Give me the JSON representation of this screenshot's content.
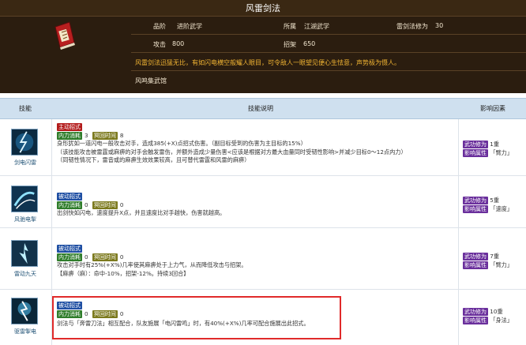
{
  "title": "风雷剑法",
  "header": {
    "grade_label": "品阶",
    "grade_value": "进阶武学",
    "faction_label": "所属",
    "faction_value": "江湖武学",
    "cultivation_label": "雷剑法修为",
    "cultivation_value": "30",
    "attack_label": "攻击",
    "attack_value": "800",
    "parry_label": "招架",
    "parry_value": "650",
    "description": "风雷剑法迅猛无比，有如闪电横空般耀人眼目，可令敌人一眼望见便心生怯意，声势极为慑人。",
    "source": "风鸣集武馆"
  },
  "columns": {
    "skill": "技能",
    "desc": "技能说明",
    "influence": "影响因素"
  },
  "rows": [
    {
      "name": "剑电闪雷",
      "type_tag": "主动招式",
      "neili_label": "内力消耗",
      "neili_value": "3",
      "cd_label": "冥回时间",
      "cd_value": "8",
      "lines": [
        "身形犹如一道闪电一般攻击对手，造成385(+X)点招式伤害。（副目标受到的伤害为主目标的15%）",
        "（该技能攻击被雷霆或麻痹的对手会触发雷伤，并额外造成少量伤害<应该是根据对方最大血量同时受韧性影响>并减少目标0～12点内力）",
        "（同韧性情况下，雷音或的麻痹生效效果较高，且可替代雷霆和风雷的麻痹）"
      ],
      "inf_tag1": "武功修为",
      "inf_val1": "1重",
      "inf_tag2": "影响属性",
      "inf_val2": "「臂力」"
    },
    {
      "name": "风驰电掣",
      "type_tag": "被动招式",
      "neili_label": "内力消耗",
      "neili_value": "0",
      "cd_label": "冥回时间",
      "cd_value": "0",
      "lines": [
        "出剑快如闪电，速度提升X点，并且速度比对手越快，伤害就越高。"
      ],
      "inf_tag1": "武功修为",
      "inf_val1": "5重",
      "inf_tag2": "影响属性",
      "inf_val2": "「速度」"
    },
    {
      "name": "雷动九天",
      "type_tag": "被动招式",
      "neili_label": "内力消耗",
      "neili_value": "0",
      "cd_label": "冥回时间",
      "cd_value": "0",
      "lines": [
        "攻击对手时有25%(+X%)几率使其麻痹处于上力气，从而降低攻击与招架。",
        "【麻痹（麻）：命中-10%，招架-12%。持续3回合】"
      ],
      "inf_tag1": "武功修为",
      "inf_val1": "7重",
      "inf_tag2": "影响属性",
      "inf_val2": "「臂力」"
    },
    {
      "name": "驱雷掣电",
      "type_tag": "被动招式",
      "neili_label": "内力消耗",
      "neili_value": "0",
      "cd_label": "冥回时间",
      "cd_value": "0",
      "lines": [
        "剑法与「奔雷刀法」相互配合，队友施展「电闪雷鸣」时，有40%(+X%)几率可配合施展出此招式。"
      ],
      "inf_tag1": "武功修为",
      "inf_val1": "10重",
      "inf_tag2": "影响属性",
      "inf_val2": "「身法」"
    }
  ]
}
